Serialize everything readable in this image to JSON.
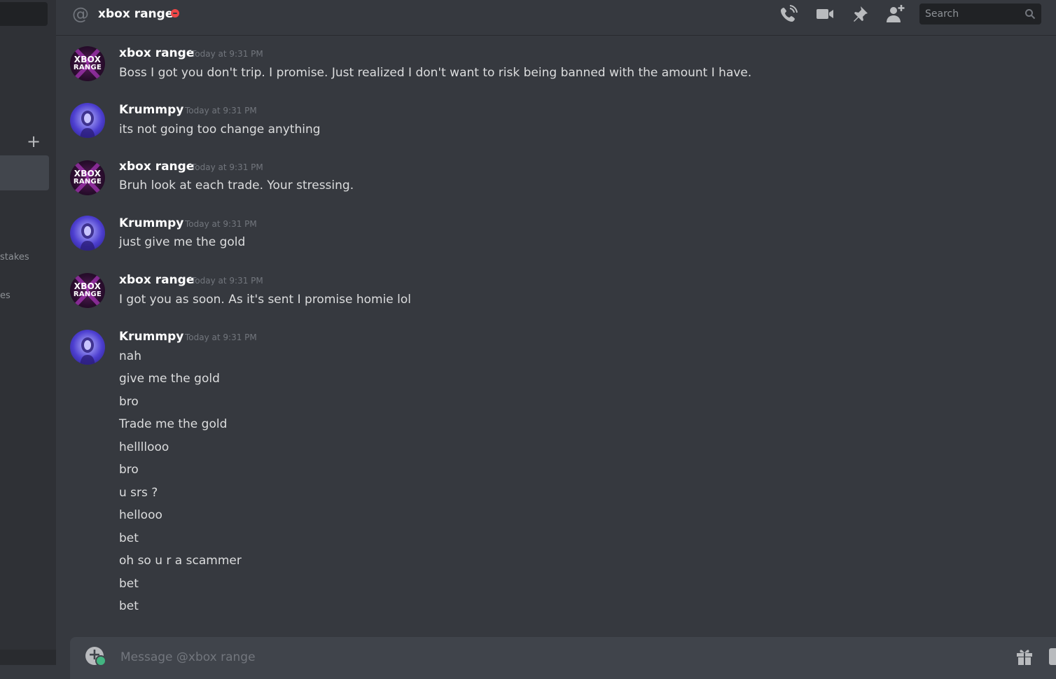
{
  "sidebar": {
    "add_icon": "+",
    "fragments": [
      "stakes",
      "es"
    ]
  },
  "header": {
    "at_symbol": "@",
    "title": "xbox range",
    "status": "do-not-disturb",
    "icons": [
      "call-icon",
      "video-icon",
      "pin-icon",
      "add-friend-icon"
    ],
    "search_placeholder": "Search"
  },
  "messages": [
    {
      "author": "xbox range",
      "avatar_text": [
        "XBOX",
        "RANGE"
      ],
      "timestamp": "Today at 9:31 PM",
      "lines": [
        "Boss I got you don't trip. I promise. Just realized I don't want to risk being banned with the amount I have."
      ]
    },
    {
      "author": "Krummpy",
      "timestamp": "Today at 9:31 PM",
      "lines": [
        "its not going too change anything"
      ]
    },
    {
      "author": "xbox range",
      "avatar_text": [
        "XBOX",
        "RANGE"
      ],
      "timestamp": "Today at 9:31 PM",
      "lines": [
        "Bruh look at each trade. Your stressing."
      ]
    },
    {
      "author": "Krummpy",
      "timestamp": "Today at 9:31 PM",
      "lines": [
        "just give me the gold"
      ]
    },
    {
      "author": "xbox range",
      "avatar_text": [
        "XBOX",
        "RANGE"
      ],
      "timestamp": "Today at 9:31 PM",
      "lines": [
        "I got you as soon. As it's sent I promise homie lol"
      ]
    },
    {
      "author": "Krummpy",
      "timestamp": "Today at 9:31 PM",
      "lines": [
        "nah",
        "give me the gold",
        "bro",
        "Trade me the gold",
        "hellllooo",
        "bro",
        "u srs ?",
        "hellooo",
        "bet",
        "oh so u r a scammer",
        "bet",
        "bet"
      ]
    }
  ],
  "composer": {
    "placeholder": "Message @xbox range"
  },
  "colors": {
    "background": "#36393f",
    "sidebar": "#2f3136",
    "dnd": "#f04747",
    "username": "#ffffff",
    "text": "#dcddde",
    "timestamp": "#72767d"
  }
}
